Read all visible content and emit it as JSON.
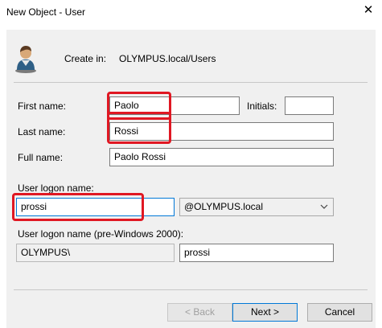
{
  "window": {
    "title": "New Object - User",
    "close_glyph": "✕"
  },
  "header": {
    "create_in_label": "Create in:",
    "create_in_path": "OLYMPUS.local/Users",
    "icon": "user-icon"
  },
  "form": {
    "first_name_label": "First name:",
    "first_name_value": "Paolo",
    "initials_label": "Initials:",
    "initials_value": "",
    "last_name_label": "Last name:",
    "last_name_value": "Rossi",
    "full_name_label": "Full name:",
    "full_name_value": "Paolo Rossi",
    "logon_name_label": "User logon name:",
    "logon_name_value": "prossi",
    "domain_suffix_value": "@OLYMPUS.local",
    "pre2000_label": "User logon name (pre-Windows 2000):",
    "pre2000_domain_value": "OLYMPUS\\",
    "pre2000_name_value": "prossi"
  },
  "buttons": {
    "back_label": "< Back",
    "next_label": "Next >",
    "cancel_label": "Cancel"
  },
  "colors": {
    "highlight": "#e01823",
    "focus_border": "#0078d7",
    "panel_bg": "#f0f0f0"
  }
}
